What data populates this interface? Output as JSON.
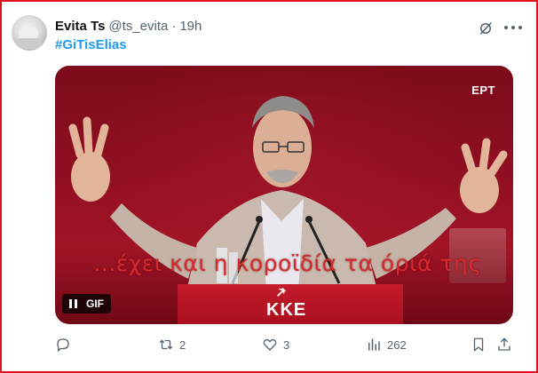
{
  "tweet": {
    "author_name": "Evita Ts",
    "handle": "@ts_evita",
    "separator": "·",
    "time": "19h",
    "hashtag": "#GiTisElias"
  },
  "media": {
    "type": "gif",
    "broadcaster_logo": "ΕΡΤ",
    "subtitle": "...έχει και η κοροϊδία τα όριά της",
    "podium_text": "ΚΚΕ",
    "gif_label": "GIF",
    "pause_icon": "pause-icon"
  },
  "actions": {
    "reply": {
      "icon": "reply-icon",
      "count": ""
    },
    "repost": {
      "icon": "repost-icon",
      "count": "2"
    },
    "like": {
      "icon": "heart-icon",
      "count": "3"
    },
    "views": {
      "icon": "views-icon",
      "count": "262"
    },
    "bookmark": {
      "icon": "bookmark-icon"
    },
    "share": {
      "icon": "share-icon"
    }
  },
  "colors": {
    "accent": "#1d9bf0",
    "secondary_text": "#536471",
    "frame_border": "#e0141e"
  }
}
